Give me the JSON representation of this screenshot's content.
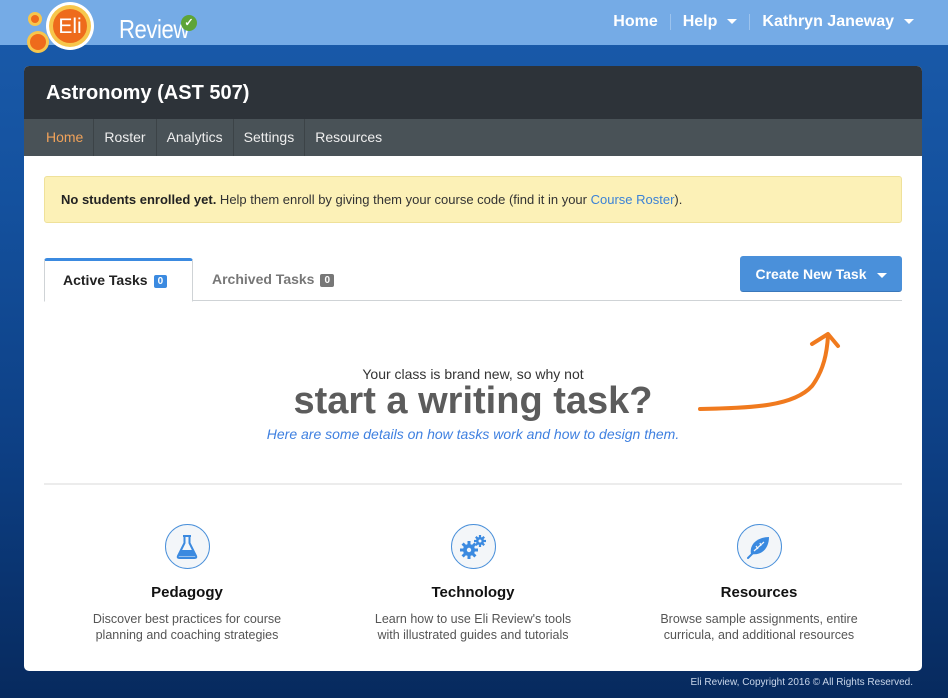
{
  "app": {
    "logo_text": "Review",
    "logo_mark": "Eli",
    "status_icon": "check-circle-icon"
  },
  "topnav": {
    "home": "Home",
    "help": "Help",
    "user": "Kathryn Janeway"
  },
  "course": {
    "title": "Astronomy (AST 507)",
    "nav": [
      {
        "label": "Home",
        "active": true
      },
      {
        "label": "Roster"
      },
      {
        "label": "Analytics"
      },
      {
        "label": "Settings"
      },
      {
        "label": "Resources"
      }
    ]
  },
  "alert": {
    "bold": "No students enrolled yet.",
    "text": " Help them enroll by giving them your course code (find it in your ",
    "link": "Course Roster",
    "end": ")."
  },
  "tabs": [
    {
      "label": "Active Tasks",
      "count": "0",
      "active": true
    },
    {
      "label": "Archived Tasks",
      "count": "0",
      "active": false
    }
  ],
  "create_button": "Create New Task",
  "hero": {
    "sub": "Your class is brand new, so why not",
    "title": "start a writing task?",
    "link": "Here are some details on how tasks work and how to design them."
  },
  "features": [
    {
      "icon": "flask-icon",
      "title": "Pedagogy",
      "desc": "Discover best practices for course planning and coaching strategies"
    },
    {
      "icon": "gears-icon",
      "title": "Technology",
      "desc": "Learn how to use Eli Review's tools with illustrated guides and tutorials"
    },
    {
      "icon": "leaf-icon",
      "title": "Resources",
      "desc": "Browse sample assignments, entire curricula, and additional resources"
    }
  ],
  "colors": {
    "accent_blue": "#3b8ae0",
    "accent_orange": "#f07a1e",
    "topbar": "#75abe6",
    "alert_bg": "#fcf1b7"
  },
  "footer": "Eli Review, Copyright 2016 © All Rights Reserved."
}
